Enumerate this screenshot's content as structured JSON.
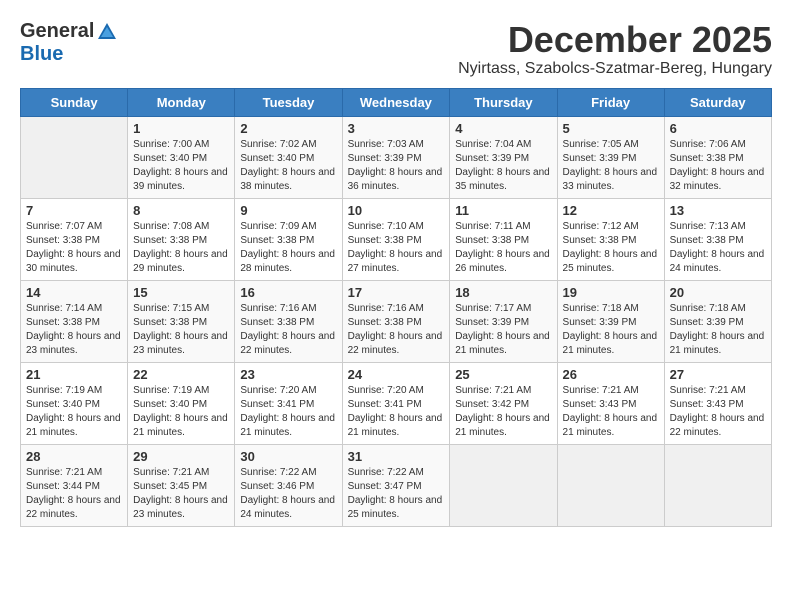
{
  "logo": {
    "general": "General",
    "blue": "Blue"
  },
  "title": {
    "month": "December 2025",
    "location": "Nyirtass, Szabolcs-Szatmar-Bereg, Hungary"
  },
  "weekdays": [
    "Sunday",
    "Monday",
    "Tuesday",
    "Wednesday",
    "Thursday",
    "Friday",
    "Saturday"
  ],
  "weeks": [
    [
      {
        "day": "",
        "sunrise": "",
        "sunset": "",
        "daylight": ""
      },
      {
        "day": "1",
        "sunrise": "Sunrise: 7:00 AM",
        "sunset": "Sunset: 3:40 PM",
        "daylight": "Daylight: 8 hours and 39 minutes."
      },
      {
        "day": "2",
        "sunrise": "Sunrise: 7:02 AM",
        "sunset": "Sunset: 3:40 PM",
        "daylight": "Daylight: 8 hours and 38 minutes."
      },
      {
        "day": "3",
        "sunrise": "Sunrise: 7:03 AM",
        "sunset": "Sunset: 3:39 PM",
        "daylight": "Daylight: 8 hours and 36 minutes."
      },
      {
        "day": "4",
        "sunrise": "Sunrise: 7:04 AM",
        "sunset": "Sunset: 3:39 PM",
        "daylight": "Daylight: 8 hours and 35 minutes."
      },
      {
        "day": "5",
        "sunrise": "Sunrise: 7:05 AM",
        "sunset": "Sunset: 3:39 PM",
        "daylight": "Daylight: 8 hours and 33 minutes."
      },
      {
        "day": "6",
        "sunrise": "Sunrise: 7:06 AM",
        "sunset": "Sunset: 3:38 PM",
        "daylight": "Daylight: 8 hours and 32 minutes."
      }
    ],
    [
      {
        "day": "7",
        "sunrise": "Sunrise: 7:07 AM",
        "sunset": "Sunset: 3:38 PM",
        "daylight": "Daylight: 8 hours and 30 minutes."
      },
      {
        "day": "8",
        "sunrise": "Sunrise: 7:08 AM",
        "sunset": "Sunset: 3:38 PM",
        "daylight": "Daylight: 8 hours and 29 minutes."
      },
      {
        "day": "9",
        "sunrise": "Sunrise: 7:09 AM",
        "sunset": "Sunset: 3:38 PM",
        "daylight": "Daylight: 8 hours and 28 minutes."
      },
      {
        "day": "10",
        "sunrise": "Sunrise: 7:10 AM",
        "sunset": "Sunset: 3:38 PM",
        "daylight": "Daylight: 8 hours and 27 minutes."
      },
      {
        "day": "11",
        "sunrise": "Sunrise: 7:11 AM",
        "sunset": "Sunset: 3:38 PM",
        "daylight": "Daylight: 8 hours and 26 minutes."
      },
      {
        "day": "12",
        "sunrise": "Sunrise: 7:12 AM",
        "sunset": "Sunset: 3:38 PM",
        "daylight": "Daylight: 8 hours and 25 minutes."
      },
      {
        "day": "13",
        "sunrise": "Sunrise: 7:13 AM",
        "sunset": "Sunset: 3:38 PM",
        "daylight": "Daylight: 8 hours and 24 minutes."
      }
    ],
    [
      {
        "day": "14",
        "sunrise": "Sunrise: 7:14 AM",
        "sunset": "Sunset: 3:38 PM",
        "daylight": "Daylight: 8 hours and 23 minutes."
      },
      {
        "day": "15",
        "sunrise": "Sunrise: 7:15 AM",
        "sunset": "Sunset: 3:38 PM",
        "daylight": "Daylight: 8 hours and 23 minutes."
      },
      {
        "day": "16",
        "sunrise": "Sunrise: 7:16 AM",
        "sunset": "Sunset: 3:38 PM",
        "daylight": "Daylight: 8 hours and 22 minutes."
      },
      {
        "day": "17",
        "sunrise": "Sunrise: 7:16 AM",
        "sunset": "Sunset: 3:38 PM",
        "daylight": "Daylight: 8 hours and 22 minutes."
      },
      {
        "day": "18",
        "sunrise": "Sunrise: 7:17 AM",
        "sunset": "Sunset: 3:39 PM",
        "daylight": "Daylight: 8 hours and 21 minutes."
      },
      {
        "day": "19",
        "sunrise": "Sunrise: 7:18 AM",
        "sunset": "Sunset: 3:39 PM",
        "daylight": "Daylight: 8 hours and 21 minutes."
      },
      {
        "day": "20",
        "sunrise": "Sunrise: 7:18 AM",
        "sunset": "Sunset: 3:39 PM",
        "daylight": "Daylight: 8 hours and 21 minutes."
      }
    ],
    [
      {
        "day": "21",
        "sunrise": "Sunrise: 7:19 AM",
        "sunset": "Sunset: 3:40 PM",
        "daylight": "Daylight: 8 hours and 21 minutes."
      },
      {
        "day": "22",
        "sunrise": "Sunrise: 7:19 AM",
        "sunset": "Sunset: 3:40 PM",
        "daylight": "Daylight: 8 hours and 21 minutes."
      },
      {
        "day": "23",
        "sunrise": "Sunrise: 7:20 AM",
        "sunset": "Sunset: 3:41 PM",
        "daylight": "Daylight: 8 hours and 21 minutes."
      },
      {
        "day": "24",
        "sunrise": "Sunrise: 7:20 AM",
        "sunset": "Sunset: 3:41 PM",
        "daylight": "Daylight: 8 hours and 21 minutes."
      },
      {
        "day": "25",
        "sunrise": "Sunrise: 7:21 AM",
        "sunset": "Sunset: 3:42 PM",
        "daylight": "Daylight: 8 hours and 21 minutes."
      },
      {
        "day": "26",
        "sunrise": "Sunrise: 7:21 AM",
        "sunset": "Sunset: 3:43 PM",
        "daylight": "Daylight: 8 hours and 21 minutes."
      },
      {
        "day": "27",
        "sunrise": "Sunrise: 7:21 AM",
        "sunset": "Sunset: 3:43 PM",
        "daylight": "Daylight: 8 hours and 22 minutes."
      }
    ],
    [
      {
        "day": "28",
        "sunrise": "Sunrise: 7:21 AM",
        "sunset": "Sunset: 3:44 PM",
        "daylight": "Daylight: 8 hours and 22 minutes."
      },
      {
        "day": "29",
        "sunrise": "Sunrise: 7:21 AM",
        "sunset": "Sunset: 3:45 PM",
        "daylight": "Daylight: 8 hours and 23 minutes."
      },
      {
        "day": "30",
        "sunrise": "Sunrise: 7:22 AM",
        "sunset": "Sunset: 3:46 PM",
        "daylight": "Daylight: 8 hours and 24 minutes."
      },
      {
        "day": "31",
        "sunrise": "Sunrise: 7:22 AM",
        "sunset": "Sunset: 3:47 PM",
        "daylight": "Daylight: 8 hours and 25 minutes."
      },
      {
        "day": "",
        "sunrise": "",
        "sunset": "",
        "daylight": ""
      },
      {
        "day": "",
        "sunrise": "",
        "sunset": "",
        "daylight": ""
      },
      {
        "day": "",
        "sunrise": "",
        "sunset": "",
        "daylight": ""
      }
    ]
  ]
}
